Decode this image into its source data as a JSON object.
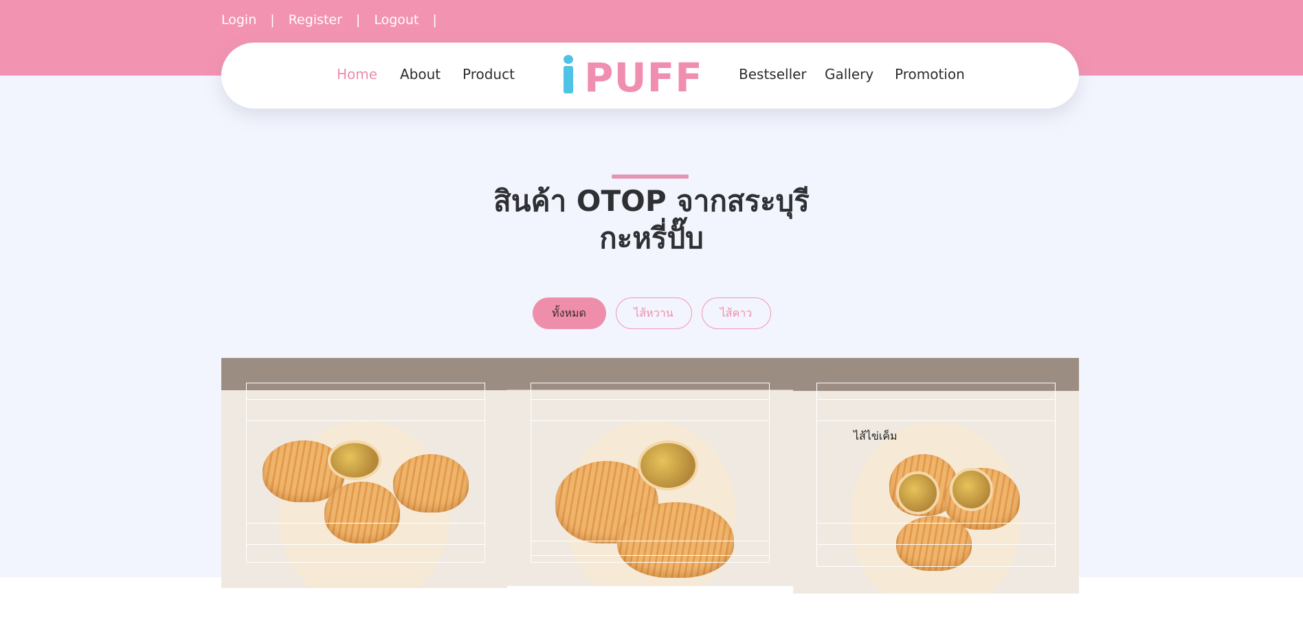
{
  "auth": {
    "login": "Login",
    "register": "Register",
    "logout": "Logout",
    "separator": "|"
  },
  "nav": {
    "home": "Home",
    "about": "About",
    "product": "Product",
    "logo_text": "PUFF",
    "bestseller": "Bestseller",
    "gallery": "Gallery",
    "promotion": "Promotion"
  },
  "section": {
    "title_line1": "สินค้า OTOP จากสระบุรี",
    "title_line2": "กะหรี่ปั๊บ"
  },
  "filters": {
    "all": "ทั้งหมด",
    "sweet": "ไส้หวาน",
    "savory": "ไส้คาว"
  },
  "products": [
    {
      "image": "puff-raisin-plate"
    },
    {
      "image": "puff-savory-bowl"
    },
    {
      "image": "puff-egg-tray",
      "label": "ไส้ไข่เค็ม"
    }
  ],
  "colors": {
    "brand_pink": "#f293b1",
    "logo_blue": "#4fc3e6",
    "background": "#f2f5fd"
  }
}
